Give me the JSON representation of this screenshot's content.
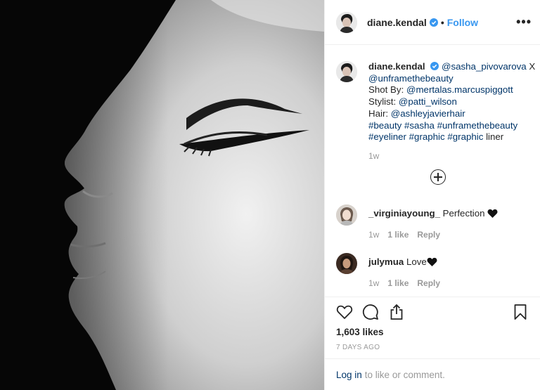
{
  "photo": {
    "description_icon": "profile-portrait"
  },
  "header": {
    "username": "diane.kendal",
    "separator": "•",
    "follow_label": "Follow",
    "more_label": "•••"
  },
  "caption": {
    "username": "diane.kendal",
    "mention1": "@sasha_pivovarova",
    "x": " X",
    "mention2": "@unframethebeauty",
    "shot_label": "Shot By: ",
    "mention3": "@mertalas.marcuspiggott",
    "stylist_label": "Stylist: ",
    "mention4": "@patti_wilson",
    "hair_label": "Hair: ",
    "mention5": "@ashleyjavierhair",
    "tags1": "#beauty #sasha #unframethebeauty",
    "tags2": "#eyeliner #graphic #graphic",
    "tags_tail": " liner",
    "time": "1w"
  },
  "comments": [
    {
      "username": "_virginiayoung_",
      "text": " Perfection ",
      "time": "1w",
      "likes": "1 like",
      "reply": "Reply"
    },
    {
      "username": "julymua",
      "text": " Love",
      "time": "1w",
      "likes": "1 like",
      "reply": "Reply"
    }
  ],
  "actions": {
    "likes": "1,603 likes",
    "ago": "7 DAYS AGO"
  },
  "login": {
    "link": "Log in",
    "rest": "to like or comment."
  },
  "colors": {
    "link": "#003569",
    "follow": "#3897f0",
    "verified": "#3897f0",
    "muted": "#999999"
  }
}
